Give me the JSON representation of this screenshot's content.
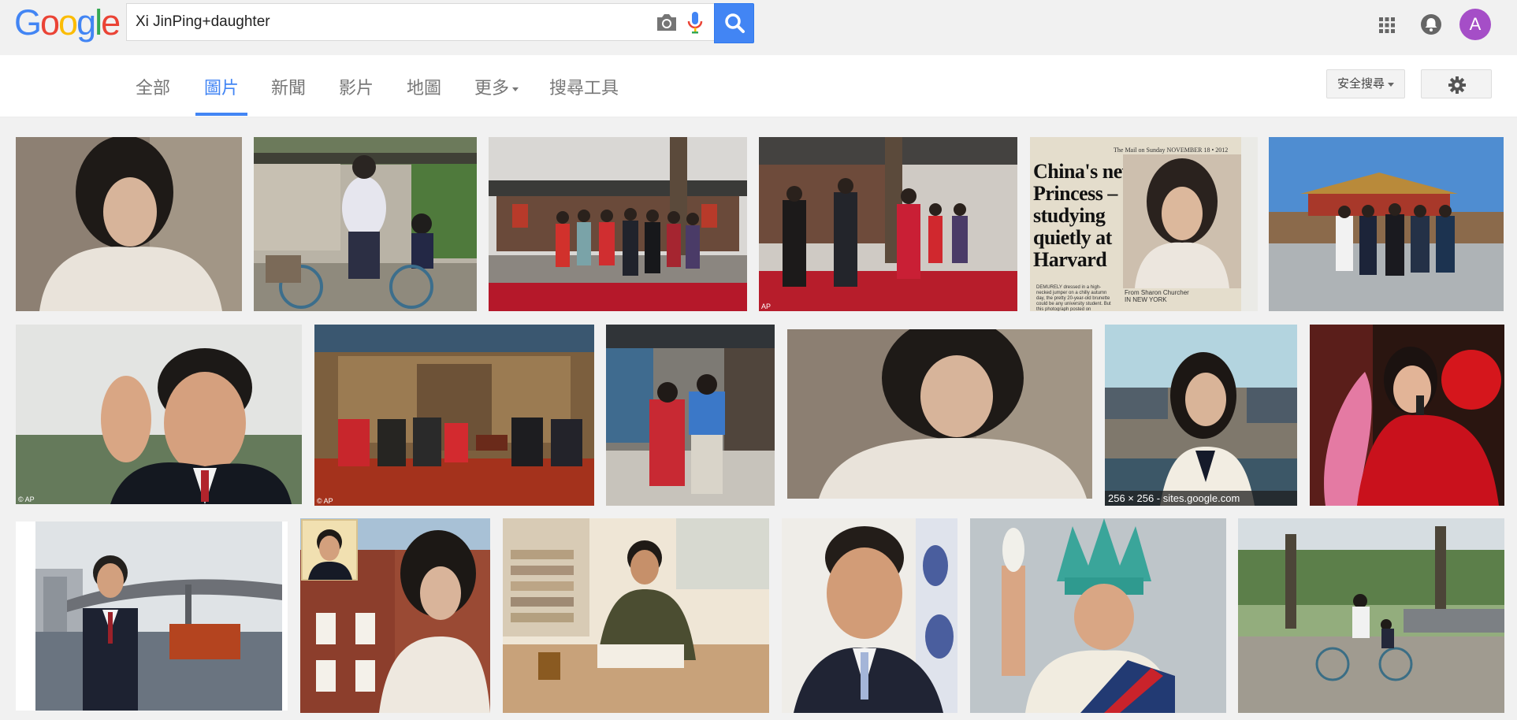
{
  "search": {
    "query": "Xi JinPing+daughter"
  },
  "logo": {
    "letters": [
      "G",
      "o",
      "o",
      "g",
      "l",
      "e"
    ],
    "colors": [
      "#4285f4",
      "#ea4335",
      "#fbbc05",
      "#4285f4",
      "#34a853",
      "#ea4335"
    ]
  },
  "account": {
    "avatar_letter": "A",
    "avatar_color": "#a54ec7"
  },
  "nav": {
    "tabs": [
      {
        "label": "全部",
        "active": false
      },
      {
        "label": "圖片",
        "active": true
      },
      {
        "label": "新聞",
        "active": false
      },
      {
        "label": "影片",
        "active": false
      },
      {
        "label": "地圖",
        "active": false
      },
      {
        "label": "更多",
        "active": false
      },
      {
        "label": "搜尋工具",
        "active": false
      }
    ],
    "safe_search_label": "安全搜尋"
  },
  "colors": {
    "accent": "#4285f4",
    "background": "#f1f1f1"
  },
  "results": {
    "newspaper": {
      "masthead": "The Mail on Sunday NOVEMBER 18 • 2012",
      "headline_lines": [
        "China's new",
        "Princess –",
        "studying",
        "quietly at",
        "Harvard"
      ],
      "byline": "From Sharon Churcher",
      "byline_location": "IN NEW YORK",
      "body_snippet": "DEMURELY dressed in a high-necked jumper on a chilly autumn day, the pretty 20-year-old brunette could be any university student. But this photograph posted on"
    },
    "watermark_ap": "© AP",
    "watermark_ap_alt": "AP",
    "hover_caption": "256 × 256 - sites.google.com"
  }
}
